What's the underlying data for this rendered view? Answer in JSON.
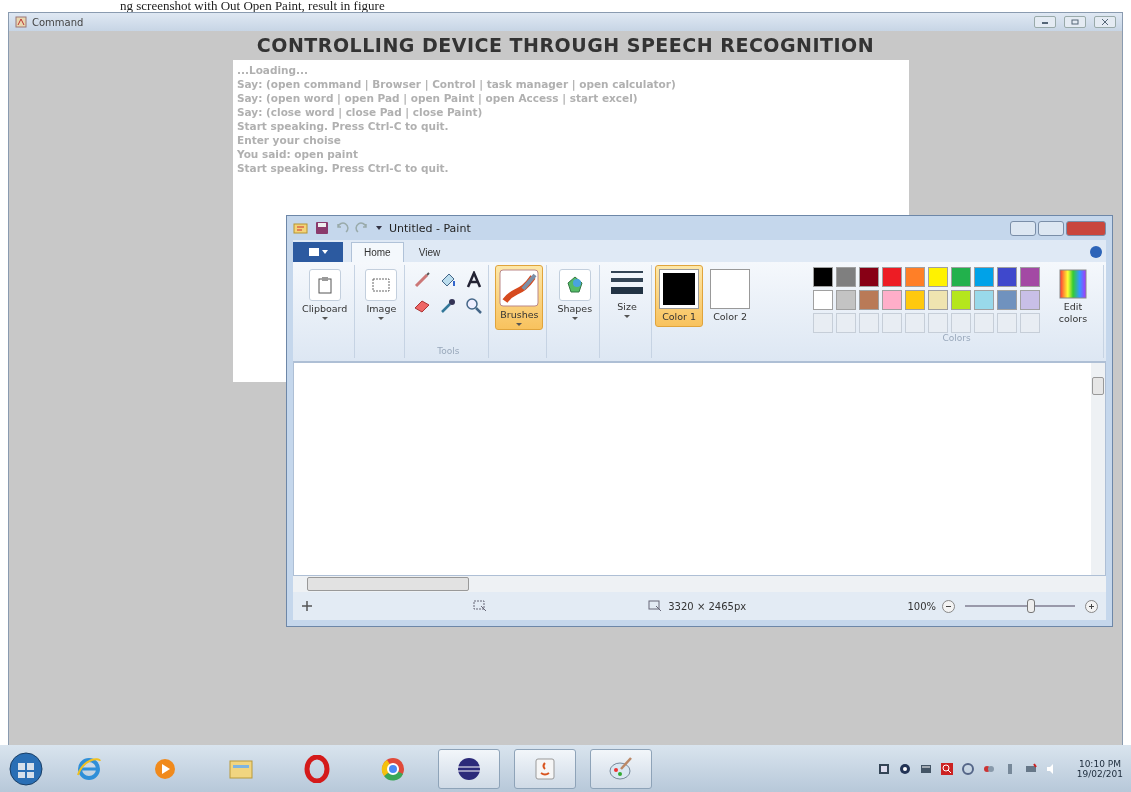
{
  "caption": "ng screenshot with Out Open Paint, result in figure",
  "command_window": {
    "title": "Command",
    "heading": "CONTROLLING DEVICE THROUGH SPEECH RECOGNITION",
    "console_lines": [
      "...Loading...",
      "Say: (open command | Browser | Control | task manager | open calculator)",
      "Say: (open word | open Pad | open Paint | open Access | start excel)",
      "Say: (close word | close Pad | close Paint)",
      "Start speaking. Press Ctrl-C to quit.",
      "Enter your choise",
      "You said: open paint",
      "Start speaking. Press Ctrl-C to quit."
    ]
  },
  "paint_window": {
    "title": "Untitled - Paint",
    "tabs": [
      {
        "label": "Home",
        "selected": true
      },
      {
        "label": "View",
        "selected": false
      }
    ],
    "ribbon": [
      {
        "kind": "clipboard",
        "label": "Clipboard"
      },
      {
        "kind": "image",
        "label": "Image"
      },
      {
        "kind": "tools",
        "label": "Tools"
      },
      {
        "kind": "brushes",
        "label": "Brushes",
        "selected": true
      },
      {
        "kind": "shapes",
        "label": "Shapes"
      },
      {
        "kind": "size",
        "label": "Size"
      },
      {
        "kind": "color1",
        "label": "Color 1",
        "selected": true
      },
      {
        "kind": "color2",
        "label": "Color 2",
        "selected": false
      },
      {
        "kind": "palette",
        "label": "Colors"
      },
      {
        "kind": "edit",
        "label": "Edit colors"
      }
    ],
    "palette": [
      {
        "color": "#000000"
      },
      {
        "color": "#7f7f7f"
      },
      {
        "color": "#880015"
      },
      {
        "color": "#ed1c24"
      },
      {
        "color": "#ff7f27"
      },
      {
        "color": "#fff200"
      },
      {
        "color": "#22b14c"
      },
      {
        "color": "#00a2e8"
      },
      {
        "color": "#3f48cc"
      },
      {
        "color": "#a349a4"
      },
      {
        "color": "#ffffff"
      },
      {
        "color": "#c3c3c3"
      },
      {
        "color": "#b97a57"
      },
      {
        "color": "#ffaec9"
      },
      {
        "color": "#ffc90e"
      },
      {
        "color": "#efe4b0"
      },
      {
        "color": "#b5e61d"
      },
      {
        "color": "#99d9ea"
      },
      {
        "color": "#7092be"
      },
      {
        "color": "#c8bfe7"
      }
    ],
    "status": {
      "dimensions": "3320 × 2465px",
      "zoom": "100%",
      "level": 0.6
    }
  },
  "taskbar": {
    "items": [
      {
        "kind": "ie",
        "open": false
      },
      {
        "kind": "media",
        "open": false
      },
      {
        "kind": "folder",
        "open": false
      },
      {
        "kind": "opera",
        "open": false
      },
      {
        "kind": "chrome",
        "open": false
      },
      {
        "kind": "eclipse",
        "open": true
      },
      {
        "kind": "java",
        "open": true
      },
      {
        "kind": "paint",
        "open": true
      }
    ],
    "time": "10:10 PM",
    "date": "19/02/201"
  }
}
